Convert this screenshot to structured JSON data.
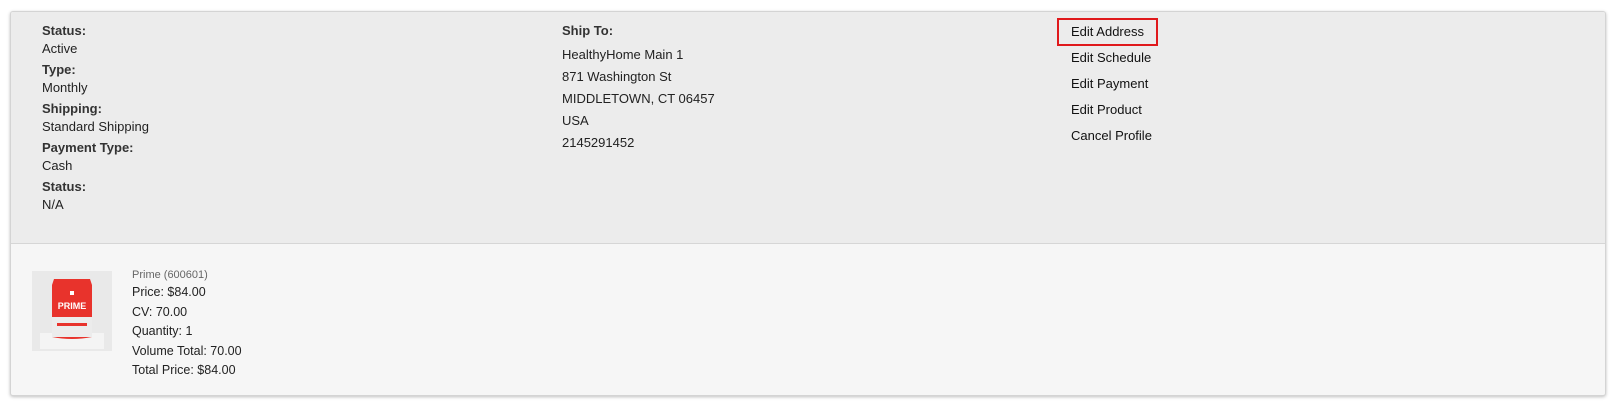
{
  "profile": {
    "status_label": "Status:",
    "status_value": "Active",
    "type_label": "Type:",
    "type_value": "Monthly",
    "shipping_label": "Shipping:",
    "shipping_value": "Standard Shipping",
    "payment_type_label": "Payment Type:",
    "payment_type_value": "Cash",
    "status2_label": "Status:",
    "status2_value": "N/A"
  },
  "ship_to": {
    "label": "Ship To:",
    "name": "HealthyHome Main 1",
    "street": "871 Washington St",
    "city_state_zip": "MIDDLETOWN, CT 06457",
    "country": "USA",
    "phone": "2145291452"
  },
  "actions": {
    "edit_address": "Edit Address",
    "edit_schedule": "Edit Schedule",
    "edit_payment": "Edit Payment",
    "edit_product": "Edit Product",
    "cancel_profile": "Cancel Profile"
  },
  "product": {
    "name": "Prime (600601)",
    "price": "Price: $84.00",
    "cv": "CV: 70.00",
    "quantity": "Quantity: 1",
    "volume_total": "Volume Total: 70.00",
    "total_price": "Total Price: $84.00",
    "image_label": "PRIME",
    "image_color": "#e8332c"
  },
  "colors": {
    "highlight_border": "#e0191c",
    "top_panel_bg": "#ececec",
    "bottom_panel_bg": "#f6f6f6"
  }
}
